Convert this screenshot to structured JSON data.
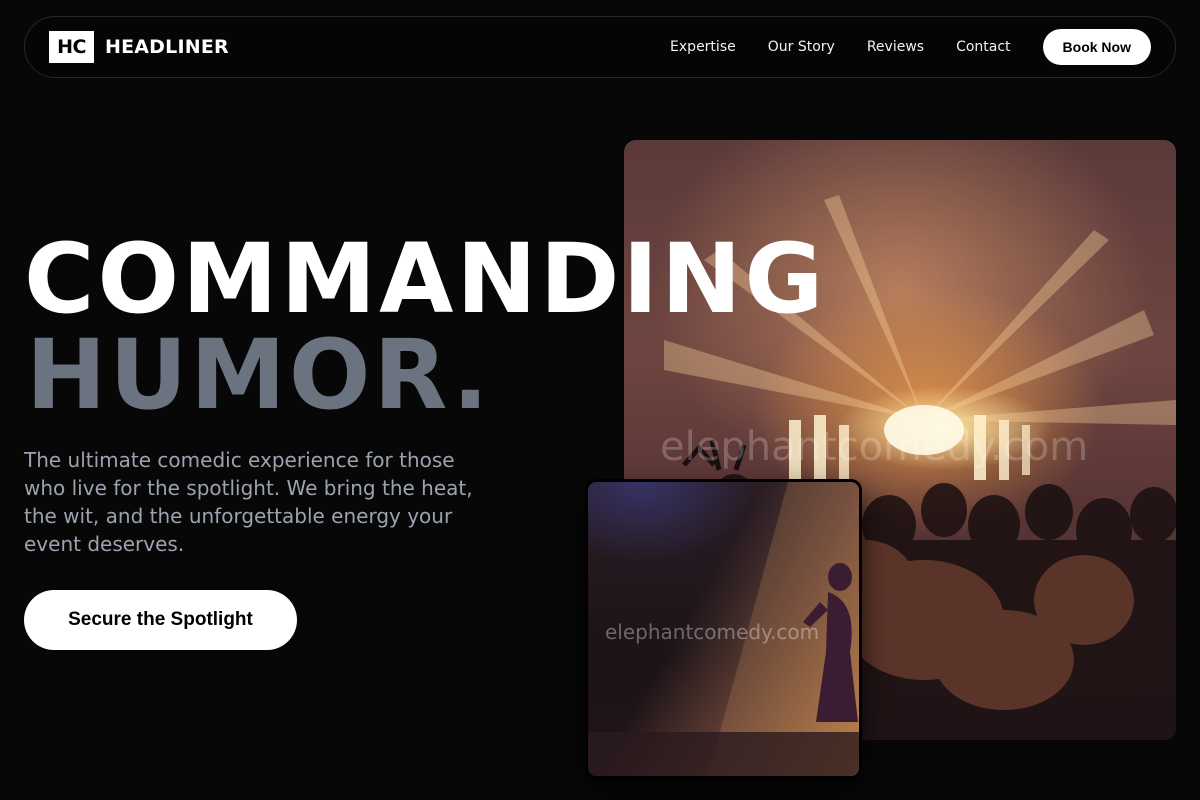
{
  "header": {
    "logo_text": "HC",
    "brand_name": "HEADLINER",
    "nav": [
      {
        "label": "Expertise"
      },
      {
        "label": "Our Story"
      },
      {
        "label": "Reviews"
      },
      {
        "label": "Contact"
      }
    ],
    "cta_label": "Book Now"
  },
  "hero": {
    "headline_line1": "COMMANDING",
    "headline_line2": "HUMOR.",
    "description": "The ultimate comedic experience for those who live for the spotlight. We bring the heat, the wit, and the unforgettable energy your event deserves.",
    "cta_label": "Secure the Spotlight"
  },
  "images": {
    "main_watermark": "elephantcomedy.com",
    "small_watermark": "elephantcomedy.com"
  },
  "colors": {
    "background": "#070707",
    "headline_primary": "#ffffff",
    "headline_secondary": "#6b7280",
    "description": "#9ca3af",
    "button_bg": "#ffffff",
    "button_text": "#000000"
  }
}
